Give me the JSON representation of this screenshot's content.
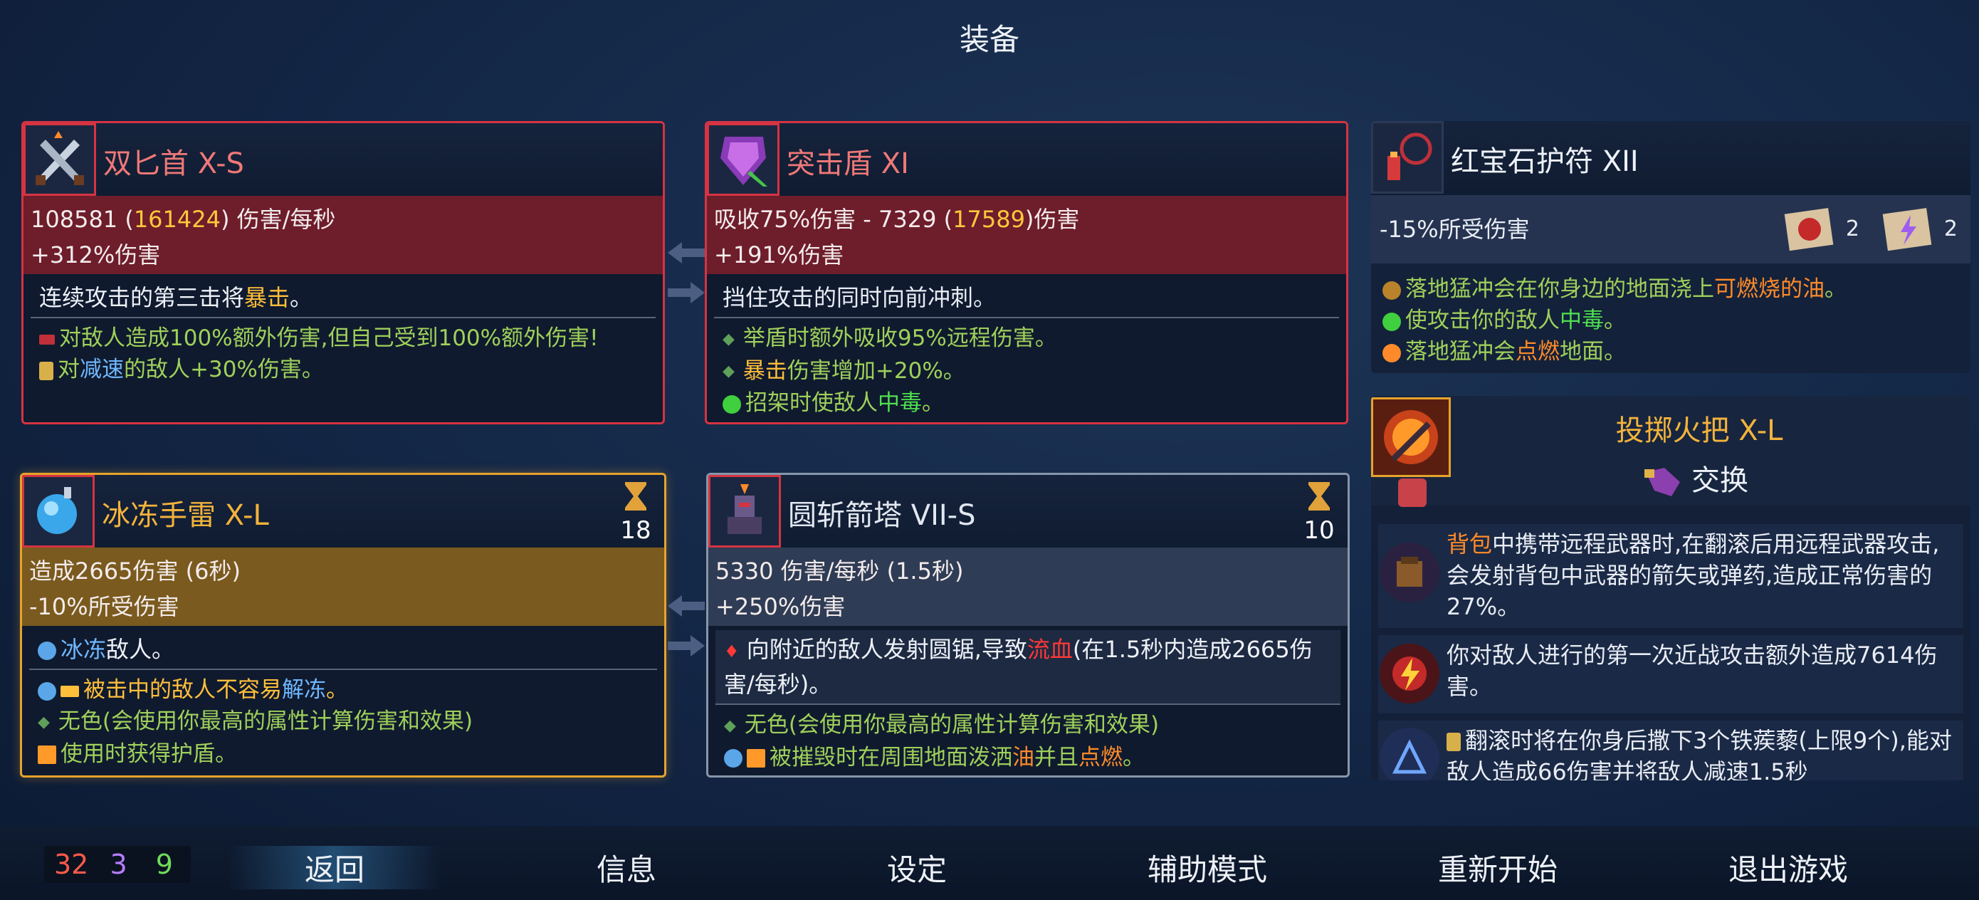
{
  "screen_title": "装备",
  "cards": {
    "dagger": {
      "name": "双匕首 X-S",
      "stat_dps_base": "108581 (",
      "stat_dps_max": "161424",
      "stat_dps_unit": ") 伤害/每秒",
      "stat_bonus": "+312%伤害",
      "main_a": "连续攻击的第三击将",
      "main_b": "暴击",
      "main_c": "。",
      "perk1": "对敌人造成100%额外伤害,但自己受到100%额外伤害!",
      "perk2_a": "对",
      "perk2_b": "减速",
      "perk2_c": "的敌人+30%伤害。"
    },
    "shield": {
      "name": "突击盾 XI",
      "stat_absorb_a": "吸收75%伤害 - 7329 (",
      "stat_absorb_b": "17589",
      "stat_absorb_c": ")伤害",
      "stat_bonus": "+191%伤害",
      "main": "挡住攻击的同时向前冲刺。",
      "perk1": "举盾时额外吸收95%远程伤害。",
      "perk2_a": "暴击",
      "perk2_b": "伤害增加+20%。",
      "perk3_a": "招架时使敌人",
      "perk3_b": "中毒",
      "perk3_c": "。"
    },
    "amulet": {
      "name": "红宝石护符 XII",
      "stat": "-15%所受伤害",
      "scroll_brutality_count": "2",
      "scroll_tactics_count": "2",
      "perk1_a": "落地猛冲会在你身边的地面浇上",
      "perk1_b": "可燃烧的油",
      "perk1_c": "。",
      "perk2_a": "使攻击你的敌人",
      "perk2_b": "中毒",
      "perk2_c": "。",
      "perk3_a": "落地猛冲会",
      "perk3_b": "点燃",
      "perk3_c": "地面。"
    },
    "grenade": {
      "name": "冰冻手雷 X-L",
      "cooldown": "18",
      "stat_damage": "造成2665伤害 (6秒)",
      "stat_resist": "-10%所受伤害",
      "main_a": "冰冻",
      "main_b": "敌人。",
      "perk1_a": "被击中的敌人不容易",
      "perk1_b": "解冻",
      "perk1_c": "。",
      "perk2": "无色(会使用你最高的属性计算伤害和效果)",
      "perk3": "使用时获得护盾。"
    },
    "turret": {
      "name": "圆斩箭塔 VII-S",
      "cooldown": "10",
      "stat_dps": "5330 伤害/每秒 (1.5秒)",
      "stat_bonus": "+250%伤害",
      "main_a": "向附近的敌人发射圆锯,导致",
      "main_b": "流血",
      "main_c": "(在1.5秒内造成2665伤害/每秒)。",
      "perk1": "无色(会使用你最高的属性计算伤害和效果)",
      "perk2_a": "被摧毁时在周围地面泼洒",
      "perk2_b": "油",
      "perk2_c": "并且",
      "perk2_d": "点燃",
      "perk2_e": "。"
    },
    "torch": {
      "name": "投掷火把 X-L",
      "swap_label": "交换",
      "mut1_a": "背包",
      "mut1_b": "中携带远程武器时,在翻滚后用远程武器攻击,会发射背包中武器的箭矢或弹药,造成正常伤害的27%。",
      "mut2": "你对敌人进行的第一次近战攻击额外造成7614伤害。",
      "mut3": "翻滚时将在你身后撒下3个铁蒺藜(上限9个),能对敌人造成66伤害并将敌人减速1.5秒"
    }
  },
  "counters": {
    "brutality": "32",
    "tactics": "3",
    "survival": "9"
  },
  "nav": {
    "back": "返回",
    "info": "信息",
    "settings": "设定",
    "assist": "辅助模式",
    "restart": "重新开始",
    "quit": "退出游戏"
  },
  "colors": {
    "brutality": "#ff5a4a",
    "tactics": "#b97cff",
    "survival": "#6fdc5a",
    "highlight_gold": "#ffc83c",
    "frame_red": "#d63342",
    "frame_gold": "#e6a32c"
  },
  "icons": [
    "twin-daggers-icon",
    "assault-shield-icon",
    "ruby-amulet-icon",
    "ice-grenade-icon",
    "saw-turret-icon",
    "throwing-torch-icon",
    "hourglass-icon",
    "scroll-brutality-icon",
    "scroll-tactics-icon",
    "swap-hand-icon"
  ]
}
